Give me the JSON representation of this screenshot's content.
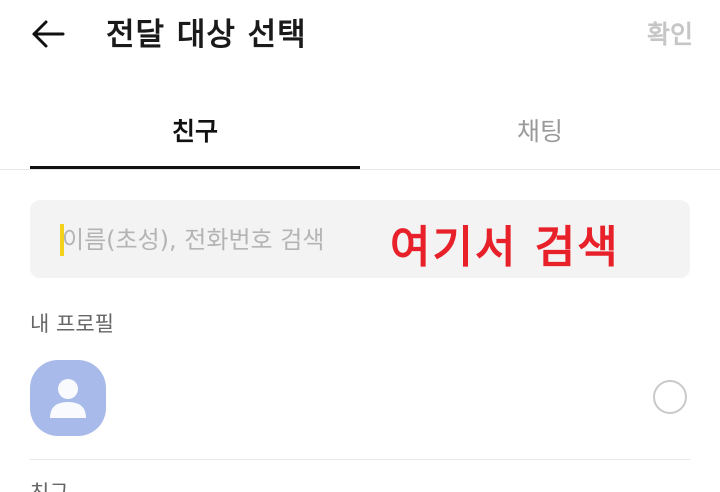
{
  "header": {
    "back_icon": "arrow-left-icon",
    "title": "전달 대상 선택",
    "confirm_label": "확인"
  },
  "tabs": [
    {
      "label": "친구",
      "selected": true
    },
    {
      "label": "채팅",
      "selected": false
    }
  ],
  "search": {
    "placeholder": "이름(초성), 전화번호 검색",
    "value": "",
    "caret_color": "#f2d21b"
  },
  "annotation": {
    "text": "여기서 검색",
    "color": "#e8202a"
  },
  "sections": {
    "my_profile_label": "내 프로필",
    "friends_label": "친구"
  },
  "profile": {
    "avatar_icon": "person-icon",
    "avatar_color": "#a8baea",
    "selected": false
  }
}
